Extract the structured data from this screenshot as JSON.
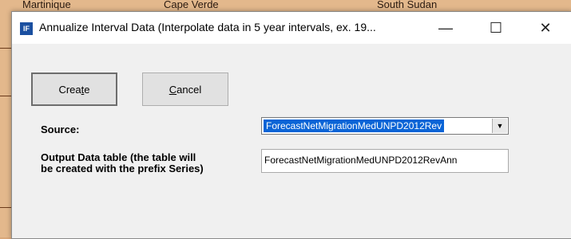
{
  "background": {
    "labels": [
      "Martinique",
      "Cape Verde",
      "South Sudan"
    ]
  },
  "window": {
    "title": "Annualize Interval Data (Interpolate data in 5 year intervals, ex. 19...",
    "icon_text": "IF",
    "controls": {
      "minimize": "—",
      "maximize": "☐",
      "close": "✕"
    }
  },
  "buttons": {
    "create_prefix": "Crea",
    "create_mnemonic": "t",
    "create_suffix": "e",
    "cancel_mnemonic": "C",
    "cancel_suffix": "ancel"
  },
  "form": {
    "source_label": "Source:",
    "source_value": "ForecastNetMigrationMedUNPD2012Rev",
    "output_label_line1": "Output Data table (the table will",
    "output_label_line2": "be created with the prefix Series)",
    "output_value": "ForecastNetMigrationMedUNPD2012RevAnn"
  },
  "colors": {
    "selection": "#0a64d6",
    "map_fill": "#e3b88c"
  }
}
